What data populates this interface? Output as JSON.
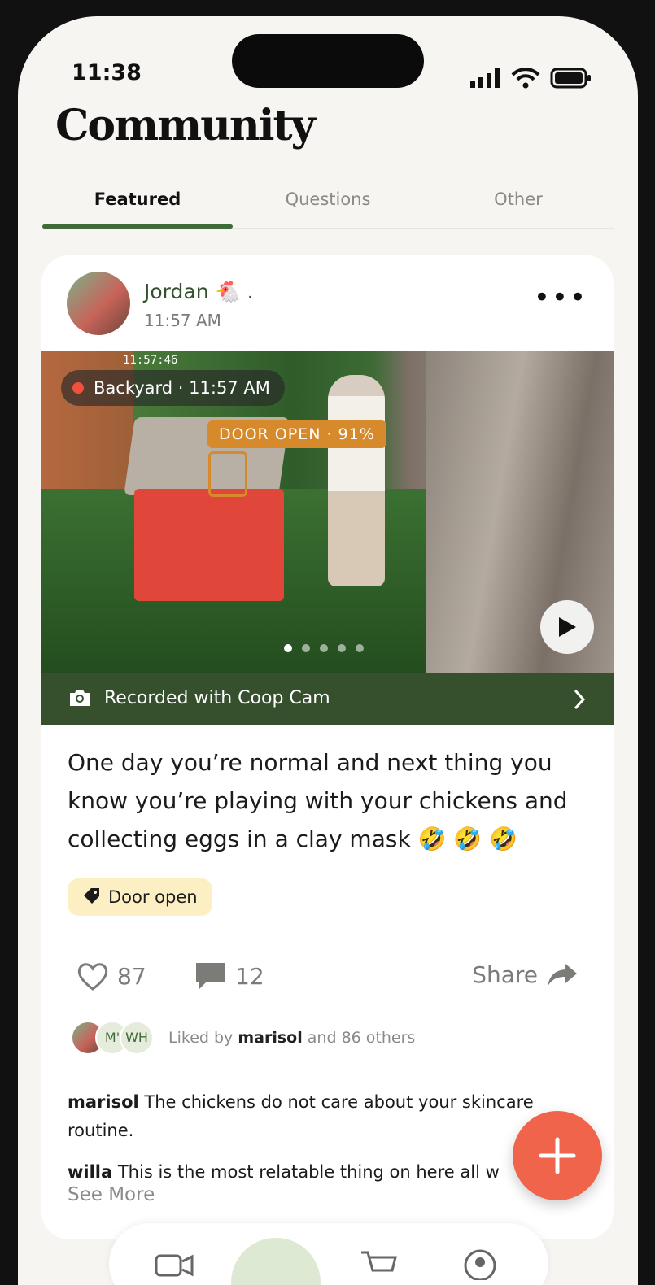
{
  "status_bar": {
    "time": "11:38"
  },
  "header": {
    "title": "Community"
  },
  "tabs": [
    {
      "label": "Featured",
      "active": true
    },
    {
      "label": "Questions",
      "active": false
    },
    {
      "label": "Other",
      "active": false
    }
  ],
  "post": {
    "author": "Jordan 🐔 .",
    "time": "11:57 AM",
    "media": {
      "overlay_timestamp": "11:57:46",
      "location_badge": "Backyard · 11:57 AM",
      "detection_label": "DOOR OPEN · 91%",
      "carousel_total": 5,
      "carousel_active": 1
    },
    "recorded_with": "Recorded with Coop Cam",
    "text": "One day you’re normal and next thing you know you’re playing with your chickens and collecting eggs in a clay mask 🤣 🤣 🤣",
    "tag": "Door open",
    "likes_count": "87",
    "comments_count": "12",
    "share_label": "Share",
    "liked_by_prefix": "Liked by",
    "liked_by_user": "marisol",
    "liked_by_suffix": "and 86 others",
    "liker_initials": [
      "M'",
      "WH"
    ],
    "comments": [
      {
        "user": "marisol",
        "text": "The chickens do not care about your skincare routine."
      },
      {
        "user": "willa",
        "text": "This is the most relatable thing on here all w"
      }
    ],
    "see_more": "See More"
  },
  "colors": {
    "accent_green": "#3e6b37",
    "cam_bar": "#36502e",
    "fab": "#f0644b",
    "tag_bg": "#fbefc3"
  }
}
